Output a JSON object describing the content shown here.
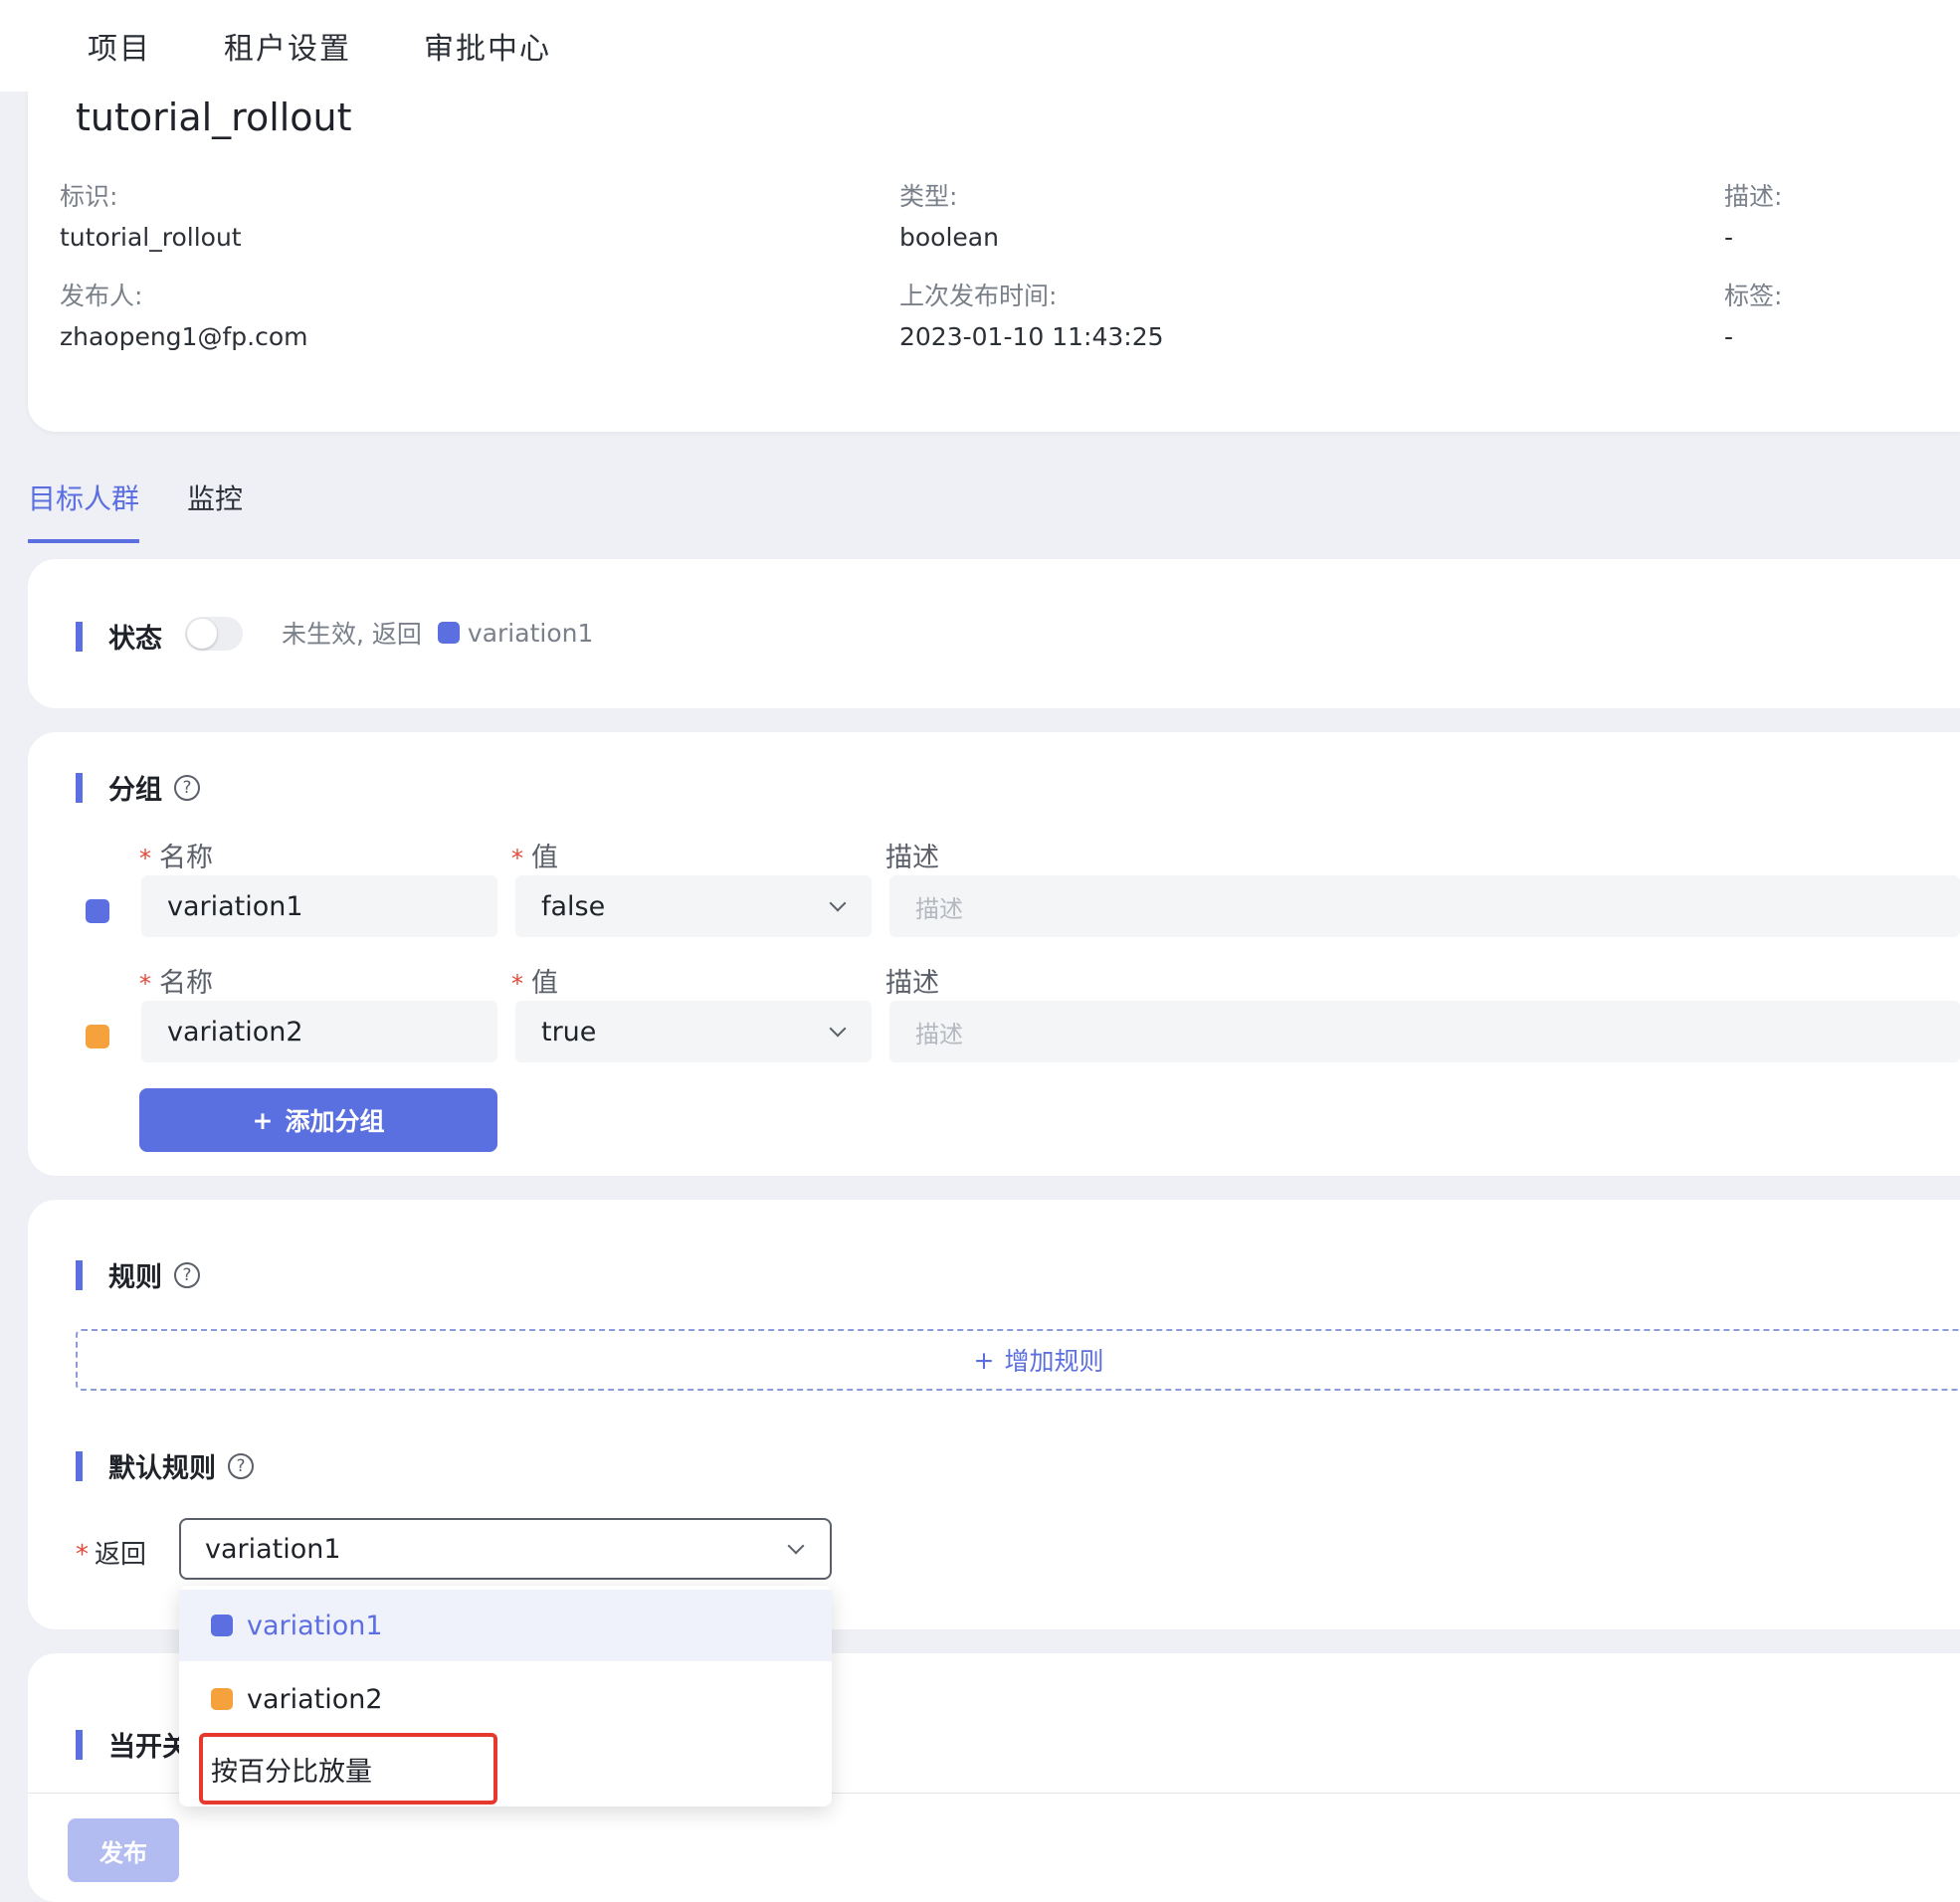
{
  "nav": {
    "items": [
      "项目",
      "租户设置",
      "审批中心"
    ]
  },
  "flag": {
    "title": "tutorial_rollout",
    "fields": {
      "key_label": "标识:",
      "key_value": "tutorial_rollout",
      "type_label": "类型:",
      "type_value": "boolean",
      "desc_label": "描述:",
      "desc_value": "-",
      "publisher_label": "发布人:",
      "publisher_value": "zhaopeng1@fp.com",
      "last_publish_label": "上次发布时间:",
      "last_publish_value": "2023-01-10 11:43:25",
      "tags_label": "标签:",
      "tags_value": "-"
    }
  },
  "tabs": [
    "目标人群",
    "监控"
  ],
  "status": {
    "title": "状态",
    "text": "未生效, 返回",
    "variation": "variation1",
    "enabled": false
  },
  "group": {
    "title": "分组",
    "help": "?",
    "name_label": "名称",
    "value_label": "值",
    "desc_label": "描述",
    "required_mark": "*",
    "rows": [
      {
        "name": "variation1",
        "value": "false",
        "desc_placeholder": "描述",
        "color": "#5b6fe0"
      },
      {
        "name": "variation2",
        "value": "true",
        "desc_placeholder": "描述",
        "color": "#f5a23c"
      }
    ],
    "add_button": "添加分组",
    "add_icon": "+"
  },
  "rules": {
    "title": "规则",
    "help": "?",
    "add_rule": "增加规则",
    "add_icon": "+"
  },
  "default_rule": {
    "title": "默认规则",
    "help": "?",
    "return_label": "返回",
    "required_mark": "*",
    "selected": "variation1",
    "options": [
      "variation1",
      "variation2",
      "按百分比放量"
    ]
  },
  "when_on": {
    "title_visible": "当开关"
  },
  "footer": {
    "publish": "发布"
  },
  "colors": {
    "accent": "#5b6fe0",
    "orange": "#f5a23c",
    "highlight": "#e5392d"
  }
}
